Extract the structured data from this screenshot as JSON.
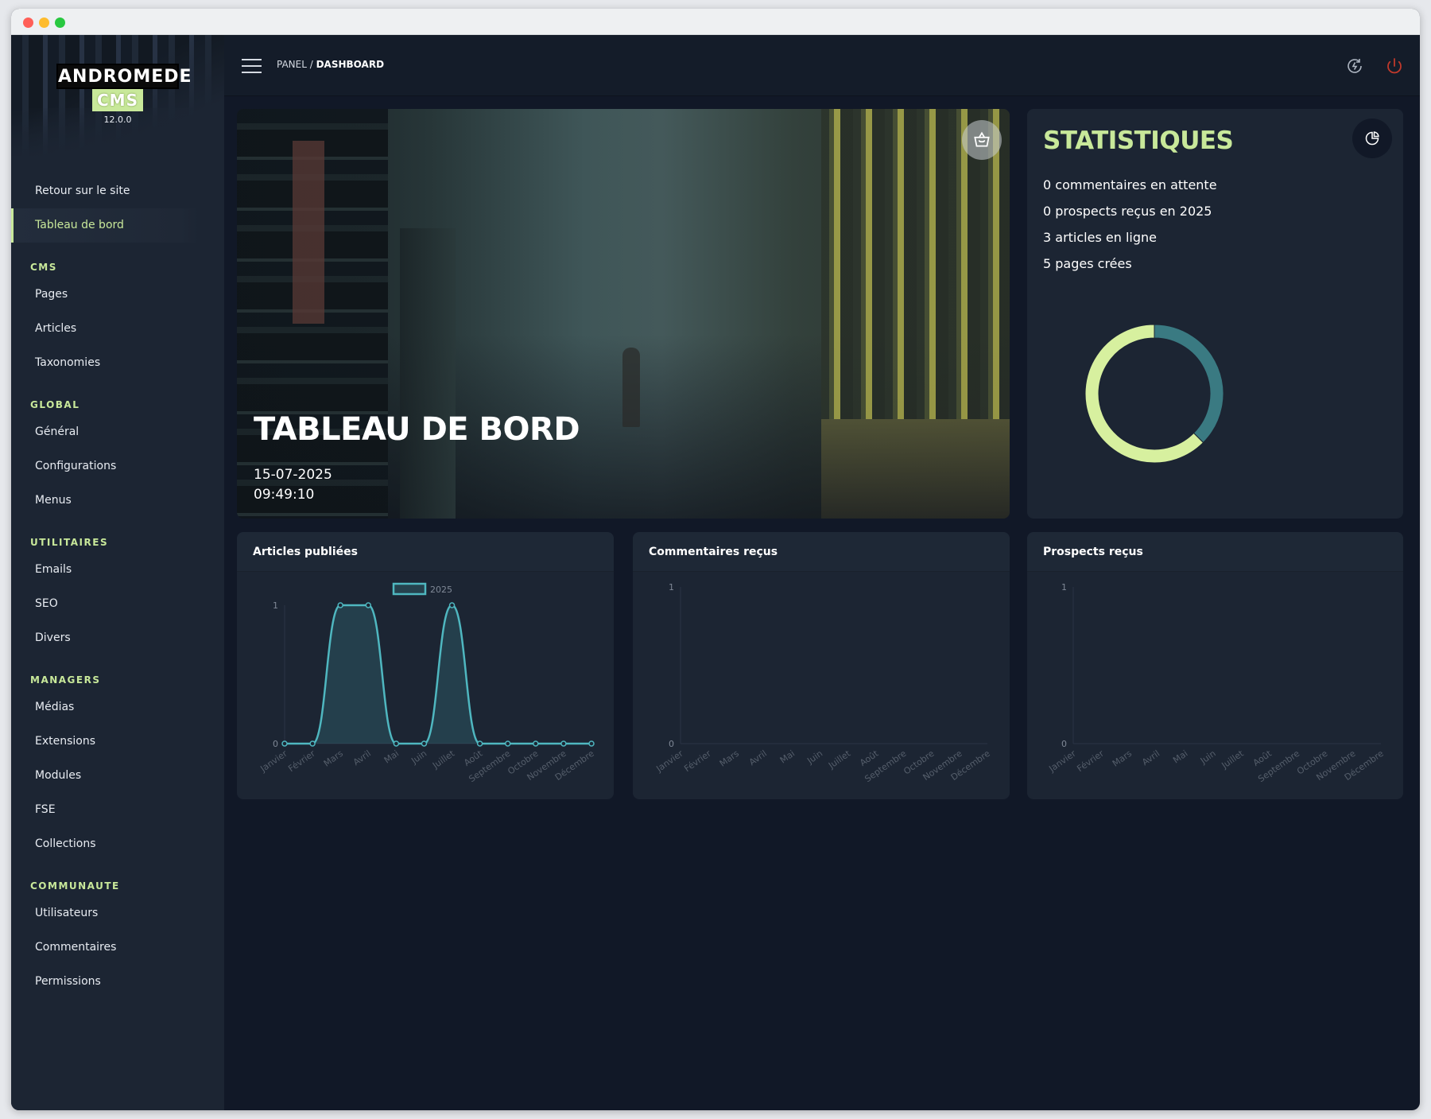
{
  "window": {
    "dots": [
      "#ff5f57",
      "#febc2e",
      "#28c840"
    ]
  },
  "logo": {
    "top": "ANDROMEDE",
    "cms": "CMS",
    "version": "12.0.0"
  },
  "sidebar": {
    "links": [
      {
        "label": "Retour sur le site",
        "active": false
      },
      {
        "label": "Tableau de bord",
        "active": true
      }
    ],
    "sections": [
      {
        "title": "CMS",
        "items": [
          "Pages",
          "Articles",
          "Taxonomies"
        ]
      },
      {
        "title": "GLOBAL",
        "items": [
          "Général",
          "Configurations",
          "Menus"
        ]
      },
      {
        "title": "UTILITAIRES",
        "items": [
          "Emails",
          "SEO",
          "Divers"
        ]
      },
      {
        "title": "MANAGERS",
        "items": [
          "Médias",
          "Extensions",
          "Modules",
          "FSE",
          "Collections"
        ]
      },
      {
        "title": "COMMUNAUTE",
        "items": [
          "Utilisateurs",
          "Commentaires",
          "Permissions"
        ]
      }
    ]
  },
  "topbar": {
    "breadcrumb_root": "PANEL",
    "breadcrumb_sep": " / ",
    "breadcrumb_current": "DASHBOARD",
    "icons": [
      "cache-refresh-icon",
      "power-icon"
    ],
    "power_color": "#c0392b"
  },
  "hero": {
    "title": "TABLEAU DE BORD",
    "date": "15-07-2025",
    "time": "09:49:10",
    "badge_icon": "basket-icon"
  },
  "stats": {
    "title": "STATISTIQUES",
    "lines": [
      "0 commentaires en attente",
      "0 prospects reçus en 2025",
      "3 articles en ligne",
      "5 pages crées"
    ],
    "icon": "pie-chart-icon"
  },
  "colors": {
    "accent": "#c8e89a",
    "teal": "#3a7a82",
    "line": "#4fb7c0"
  },
  "chart_data": [
    {
      "type": "pie",
      "title": "",
      "categories": [
        "articles en ligne",
        "pages crées"
      ],
      "values": [
        3,
        5
      ],
      "colors": [
        "#3a7a82",
        "#d7f09f"
      ]
    },
    {
      "type": "area",
      "title": "Articles publiées",
      "categories": [
        "Janvier",
        "Février",
        "Mars",
        "Avril",
        "Mai",
        "Juin",
        "Juillet",
        "Août",
        "Septembre",
        "Octobre",
        "Novembre",
        "Décembre"
      ],
      "series": [
        {
          "name": "2025",
          "values": [
            0,
            0,
            1,
            1,
            0,
            0,
            1,
            0,
            0,
            0,
            0,
            0
          ]
        }
      ],
      "ylim": [
        0,
        1
      ],
      "yticks": [
        "0",
        "1"
      ]
    },
    {
      "type": "line",
      "title": "Commentaires reçus",
      "categories": [
        "Janvier",
        "Février",
        "Mars",
        "Avril",
        "Mai",
        "Juin",
        "Juillet",
        "Août",
        "Septembre",
        "Octobre",
        "Novembre",
        "Décembre"
      ],
      "series": [],
      "ylim": [
        0,
        1
      ],
      "yticks": [
        "0",
        "1"
      ]
    },
    {
      "type": "line",
      "title": "Prospects reçus",
      "categories": [
        "Janvier",
        "Février",
        "Mars",
        "Avril",
        "Mai",
        "Juin",
        "Juillet",
        "Août",
        "Septembre",
        "Octobre",
        "Novembre",
        "Décembre"
      ],
      "series": [],
      "ylim": [
        0,
        1
      ],
      "yticks": [
        "0",
        "1"
      ]
    }
  ]
}
